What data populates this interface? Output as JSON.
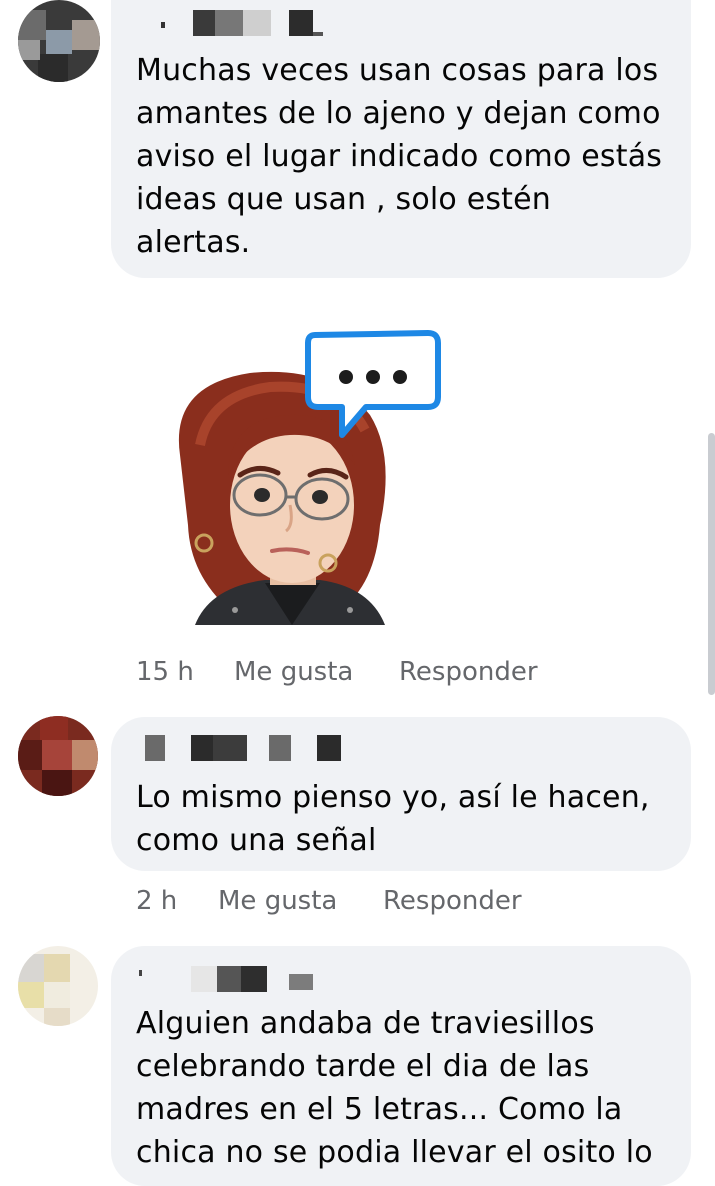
{
  "comments": [
    {
      "text": "Muchas veces usan cosas para los amantes de lo ajeno y dejan como aviso el lugar indicado como estás ideas que usan , solo estén alertas.",
      "lines": [
        "Muchas veces usan cosas para los",
        "amantes de lo ajeno y dejan como",
        "aviso el lugar indicado como estás",
        "ideas que usan , solo estén",
        "alertas."
      ],
      "time": "15 h",
      "like_label": "Me gusta",
      "reply_label": "Responder",
      "has_sticker": true,
      "sticker_icon": "typing-memoji-sticker"
    },
    {
      "lines": [
        "Lo mismo pienso yo, así le hacen,",
        "como una señal"
      ],
      "time": "2 h",
      "like_label": "Me gusta",
      "reply_label": "Responder"
    },
    {
      "lines": [
        "Alguien andaba de traviesillos",
        "celebrando tarde el dia de las",
        "madres en el 5 letras... Como la",
        "chica no se podia llevar el osito lo"
      ]
    }
  ],
  "colors": {
    "bubble_bg": "#f0f2f5",
    "meta_text": "#65676b",
    "sticker_bubble_border": "#1e88e5"
  }
}
